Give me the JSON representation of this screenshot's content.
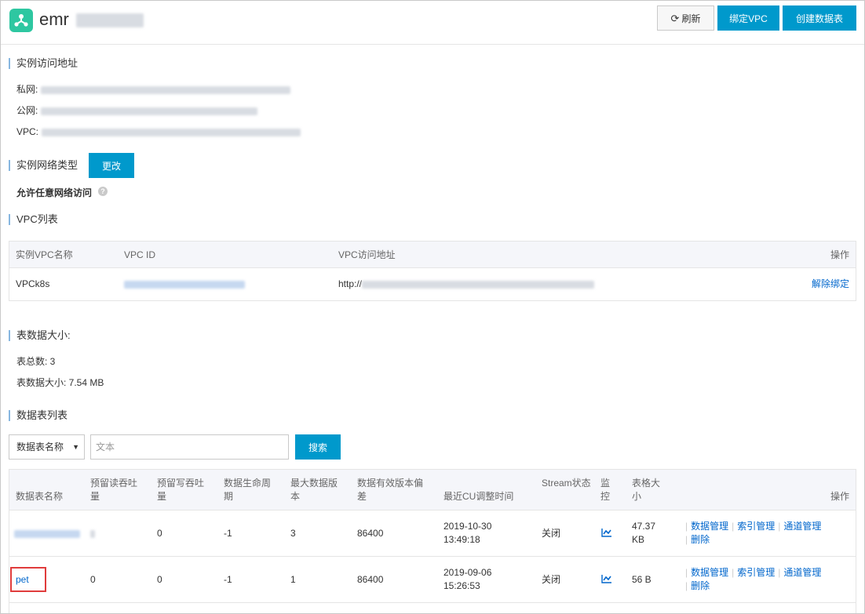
{
  "header": {
    "app_title": "emr",
    "refresh_label": "刷新",
    "bind_vpc_label": "绑定VPC",
    "create_table_label": "创建数据表",
    "brand_color": "#2ec7a1",
    "primary_color": "#0099cc"
  },
  "access": {
    "title": "实例访问地址",
    "private_label": "私网:",
    "public_label": "公网:",
    "vpc_label": "VPC:"
  },
  "network": {
    "title": "实例网络类型",
    "change_label": "更改",
    "policy": "允许任意网络访问",
    "help_icon": "?"
  },
  "vpc_list": {
    "title": "VPC列表",
    "headers": [
      "实例VPC名称",
      "VPC ID",
      "VPC访问地址",
      "操作"
    ],
    "rows": [
      {
        "name": "VPCk8s",
        "url_prefix": "http://",
        "action": "解除绑定"
      }
    ]
  },
  "size": {
    "title": "表数据大小:",
    "total_tables": "表总数: 3",
    "data_size": "表数据大小: 7.54 MB"
  },
  "tables": {
    "title": "数据表列表",
    "select_value": "数据表名称",
    "search_placeholder": "文本",
    "search_label": "搜索",
    "headers": {
      "name": "数据表名称",
      "read": "预留读吞吐量",
      "write": "预留写吞吐量",
      "ttl": "数据生命周期",
      "versions": "最大数据版本",
      "deviation": "数据有效版本偏差",
      "cu_time": "最近CU调整时间",
      "stream": "Stream状态",
      "monitor": "监控",
      "size": "表格大小",
      "actions": "操作"
    },
    "rows": [
      {
        "name": "",
        "read": "",
        "write": "0",
        "ttl": "-1",
        "versions": "3",
        "deviation": "86400",
        "cu_date": "2019-10-30",
        "cu_clock": "13:49:18",
        "stream": "关闭",
        "size_value": "47.37",
        "size_unit": "KB",
        "op_data": "数据管理",
        "op_index": "索引管理",
        "op_tunnel": "通道管理",
        "op_delete": "删除"
      },
      {
        "name": "pet",
        "read": "0",
        "write": "0",
        "ttl": "-1",
        "versions": "1",
        "deviation": "86400",
        "cu_date": "2019-09-06",
        "cu_clock": "15:26:53",
        "stream": "关闭",
        "size_value": "56 B",
        "size_unit": "",
        "op_data": "数据管理",
        "op_index": "索引管理",
        "op_tunnel": "通道管理",
        "op_delete": "删除"
      }
    ]
  }
}
